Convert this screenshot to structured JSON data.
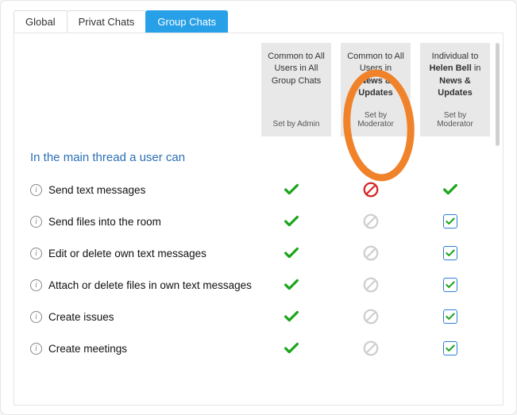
{
  "tabs": {
    "global": "Global",
    "privat": "Privat Chats",
    "group": "Group Chats"
  },
  "columns": {
    "col1": {
      "line1": "Common to All Users in All Group Chats",
      "set_by": "Set by Admin"
    },
    "col2": {
      "line1_pre": "Common to All Users in ",
      "line1_bold": "News & Updates",
      "set_by": "Set by Moderator"
    },
    "col3": {
      "line1_pre": "Individual to ",
      "line1_bold1": "Helen Bell",
      "line1_mid": " in ",
      "line1_bold2": "News & Updates",
      "set_by": "Set by Moderator"
    }
  },
  "section_heading": "In the main thread a user can",
  "permissions": {
    "send_text": "Send text messages",
    "send_files": "Send files into the room",
    "edit_delete": "Edit or delete own text messages",
    "attach_delete": "Attach or delete files in own text messages",
    "create_issues": "Create issues",
    "create_meetings": "Create meetings"
  },
  "colors": {
    "tab_active": "#28a0e8",
    "check_green": "#1aa61a",
    "denied_red": "#d62626",
    "highlight_orange": "#f08229"
  }
}
